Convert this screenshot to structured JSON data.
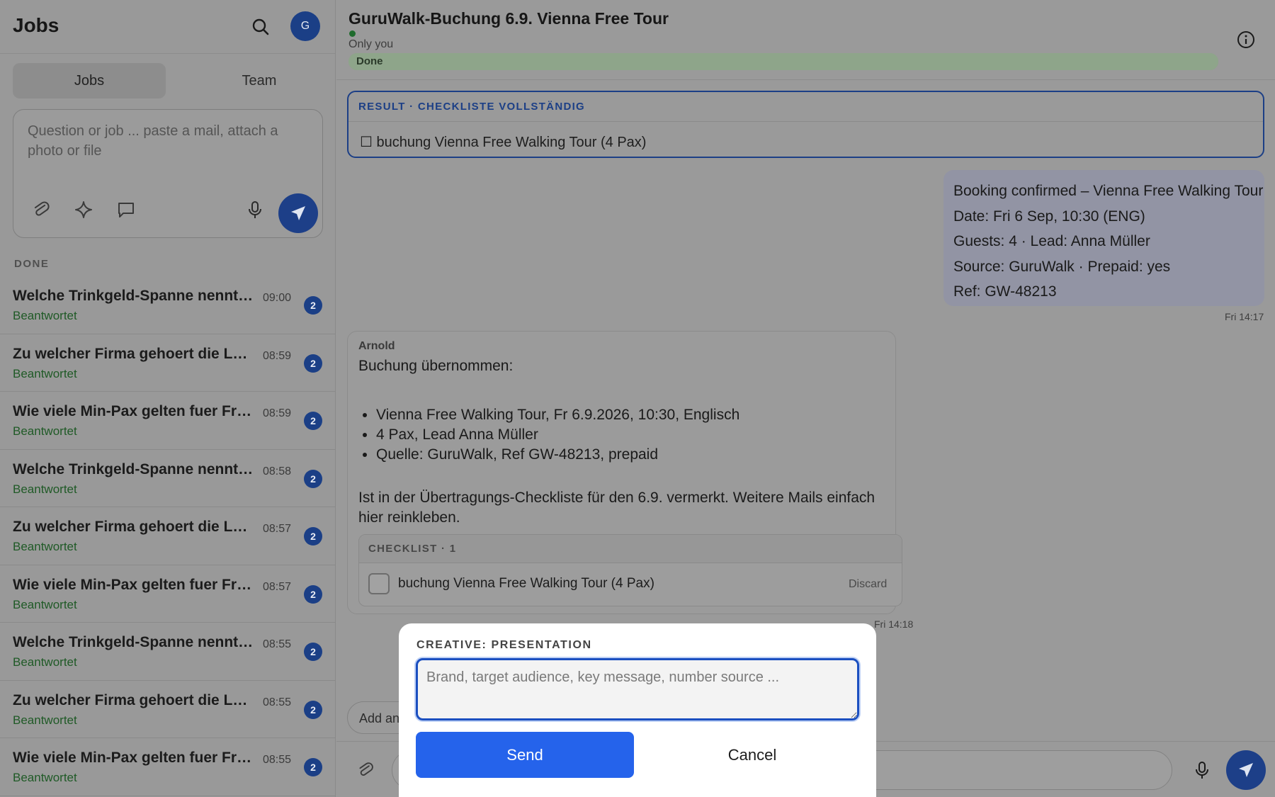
{
  "sidebar": {
    "title": "Jobs",
    "avatar_initial": "G",
    "tabs": [
      {
        "label": "Jobs",
        "active": true
      },
      {
        "label": "Team",
        "active": false
      }
    ],
    "composer": {
      "placeholder": "Question or job ... paste a mail, attach a photo or file",
      "icons": [
        "paperclip-icon",
        "sparkle-icon",
        "chat-icon",
        "microphone-icon",
        "send-icon"
      ]
    },
    "section_label": "DONE",
    "jobs": [
      {
        "title": "Welche Trinkgeld-Spanne nennt ...",
        "time": "09:00",
        "status": "Beantwortet",
        "badge": "2"
      },
      {
        "title": "Zu welcher Firma gehoert die Lea...",
        "time": "08:59",
        "status": "Beantwortet",
        "badge": "2"
      },
      {
        "title": "Wie viele Min-Pax gelten fuer Fre...",
        "time": "08:59",
        "status": "Beantwortet",
        "badge": "2"
      },
      {
        "title": "Welche Trinkgeld-Spanne nennt ...",
        "time": "08:58",
        "status": "Beantwortet",
        "badge": "2"
      },
      {
        "title": "Zu welcher Firma gehoert die Lea...",
        "time": "08:57",
        "status": "Beantwortet",
        "badge": "2"
      },
      {
        "title": "Wie viele Min-Pax gelten fuer Fre...",
        "time": "08:57",
        "status": "Beantwortet",
        "badge": "2"
      },
      {
        "title": "Welche Trinkgeld-Spanne nennt ...",
        "time": "08:55",
        "status": "Beantwortet",
        "badge": "2"
      },
      {
        "title": "Zu welcher Firma gehoert die Lea...",
        "time": "08:55",
        "status": "Beantwortet",
        "badge": "2"
      },
      {
        "title": "Wie viele Min-Pax gelten fuer Fre...",
        "time": "08:55",
        "status": "Beantwortet",
        "badge": "2"
      }
    ]
  },
  "chat": {
    "title": "GuruWalk-Buchung 6.9. Vienna Free Tour",
    "visibility": "Only you",
    "progress_label": "Done",
    "progress_fraction": 1.0,
    "result": {
      "label": "RESULT · CHECKLISTE VOLLSTÄNDIG",
      "item": "☐ buchung Vienna Free Walking Tour (4 Pax)"
    },
    "outgoing": {
      "lines": [
        "Booking confirmed – Vienna Free Walking Tour",
        "Date: Fri 6 Sep, 10:30 (ENG)",
        "Guests: 4 · Lead: Anna Müller",
        "Source: GuruWalk · Prepaid: yes",
        "Ref: GW-48213"
      ],
      "timestamp": "Fri 14:17"
    },
    "incoming": {
      "sender": "Arnold",
      "intro": "Buchung übernommen:",
      "bullets": [
        "Vienna Free Walking Tour, Fr 6.9.2026, 10:30, Englisch",
        "4 Pax, Lead Anna Müller",
        "Quelle: GuruWalk, Ref GW-48213, prepaid"
      ],
      "outro": "Ist in der Übertragungs-Checkliste für den 6.9. vermerkt. Weitere Mails einfach hier reinkleben.",
      "checklist_header": "CHECKLIST · 1",
      "checklist_item": "buchung Vienna Free Walking Tour (4 Pax)",
      "discard_label": "Discard",
      "timestamp": "Fri 14:18"
    },
    "annotation_chip": "Add an"
  },
  "modal": {
    "label": "CREATIVE: PRESENTATION",
    "placeholder": "Brand, target audience, key message, number source ...",
    "send_label": "Send",
    "cancel_label": "Cancel"
  },
  "colors": {
    "accent": "#1c3f86",
    "primary_button": "#2563eb",
    "status_green": "#1f5a26"
  }
}
